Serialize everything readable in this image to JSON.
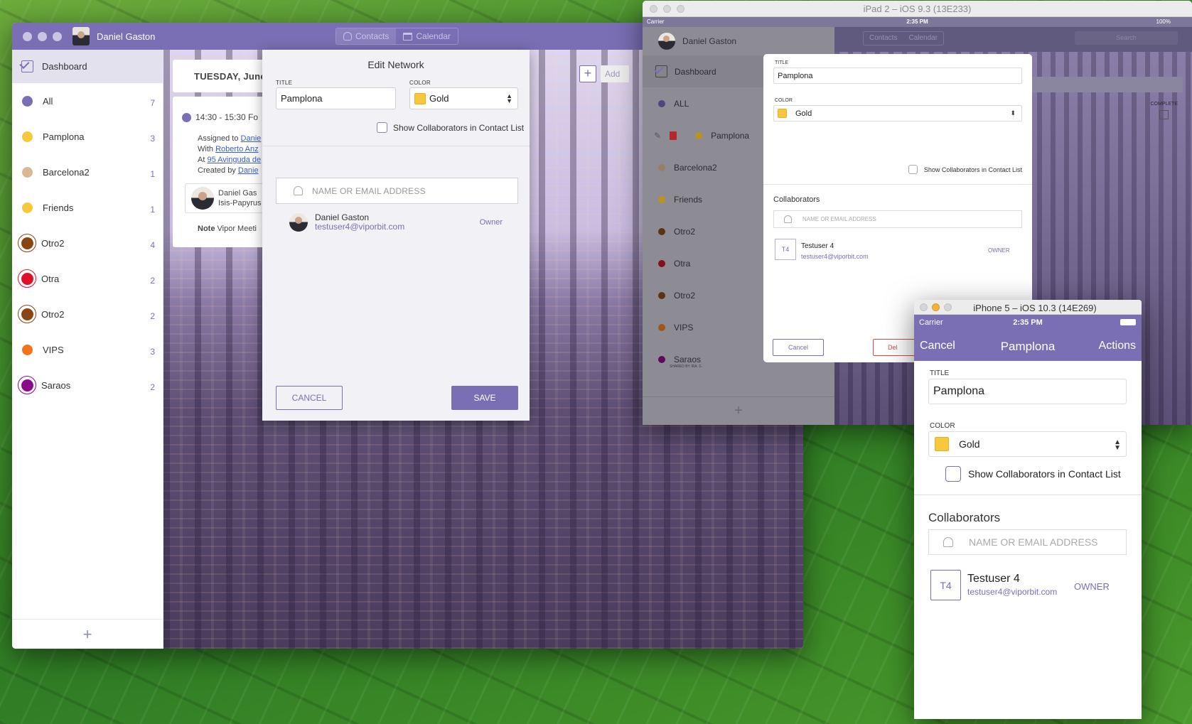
{
  "mac": {
    "user_name": "Daniel Gaston",
    "tabs": [
      "Contacts",
      "Calendar"
    ],
    "sidebar": {
      "dashboard": "Dashboard",
      "items": [
        {
          "label": "All",
          "count": "7",
          "color": "#7a6fb4",
          "style": "dot"
        },
        {
          "label": "Pamplona",
          "count": "3",
          "color": "#f6c83a",
          "style": "dot"
        },
        {
          "label": "Barcelona2",
          "count": "1",
          "color": "#d9b896",
          "style": "dot"
        },
        {
          "label": "Friends",
          "count": "1",
          "color": "#f6c83a",
          "style": "dot"
        },
        {
          "label": "Otro2",
          "count": "4",
          "color": "#8b4513",
          "style": "ring"
        },
        {
          "label": "Otra",
          "count": "2",
          "color": "#e0102a",
          "style": "ring"
        },
        {
          "label": "Otro2",
          "count": "2",
          "color": "#8b4513",
          "style": "ring"
        },
        {
          "label": "VIPS",
          "count": "3",
          "color": "#f2731c",
          "style": "dot"
        },
        {
          "label": "Saraos",
          "count": "2",
          "color": "#8b0a8b",
          "style": "ring"
        }
      ],
      "add": "+"
    },
    "date_header": "TUESDAY, June",
    "add_button": "Add",
    "event": {
      "time": "14:30 - 15:30 Fo",
      "assigned_label": "Assigned to",
      "assigned_link": "Danie",
      "with_label": "With",
      "with_link": "Roberto Anz",
      "at_label": "At",
      "at_link": "95 Avinguda de",
      "created_label": "Created by",
      "created_link": "Danie",
      "contact_name": "Daniel Gas",
      "contact_company": "Isis-Papyrus",
      "note_label": "Note",
      "note_text": "Vipor Meeti"
    },
    "modal": {
      "title": "Edit Network",
      "title_label": "TITLE",
      "title_value": "Pamplona",
      "color_label": "COLOR",
      "color_value": "Gold",
      "show_collab": "Show Collaborators in Contact List",
      "search_placeholder": "NAME OR EMAIL ADDRESS",
      "collaborator": {
        "name": "Daniel Gaston",
        "email": "testuser4@viporbit.com",
        "role": "Owner"
      },
      "cancel": "CANCEL",
      "save": "SAVE"
    }
  },
  "ipad": {
    "window_title": "iPad 2 – iOS 9.3 (13E233)",
    "carrier": "Carrier",
    "time": "2:35 PM",
    "battery": "100%",
    "user_name": "Daniel Gaston",
    "tabs": [
      "Contacts",
      "Calendar"
    ],
    "search": "Search",
    "dashboard": "Dashboard",
    "items": [
      {
        "label": "ALL",
        "color": "#4c4680"
      },
      {
        "label": "Pamplona",
        "color": "#b89322"
      },
      {
        "label": "Barcelona2",
        "color": "#9a7f66"
      },
      {
        "label": "Friends",
        "color": "#b89322"
      },
      {
        "label": "Otro2",
        "color": "#5a3314"
      },
      {
        "label": "Otra",
        "color": "#8a0c1c"
      },
      {
        "label": "Otro2",
        "color": "#5a3314"
      },
      {
        "label": "VIPS",
        "color": "#a35418"
      },
      {
        "label": "Saraos",
        "color": "#5c0a5c"
      }
    ],
    "saraos_sub": "SHARED BY IRA. S.",
    "complete_label": "COMPLETE",
    "sheet": {
      "title_label": "TITLE",
      "title_value": "Pamplona",
      "color_label": "COLOR",
      "color_value": "Gold",
      "show_collab": "Show Collaborators in Contact List",
      "collab_header": "Collaborators",
      "search_placeholder": "NAME OR EMAIL ADDRESS",
      "initials": "T4",
      "name": "Testuser 4",
      "email": "testuser4@viporbit.com",
      "role": "OWNER",
      "cancel": "Cancel",
      "delete": "Del"
    }
  },
  "iphone": {
    "window_title": "iPhone 5 – iOS 10.3 (14E269)",
    "carrier": "Carrier",
    "time": "2:35 PM",
    "nav_cancel": "Cancel",
    "nav_title": "Pamplona",
    "nav_actions": "Actions",
    "title_label": "TITLE",
    "title_value": "Pamplona",
    "color_label": "COLOR",
    "color_value": "Gold",
    "show_collab": "Show Collaborators in Contact List",
    "collab_header": "Collaborators",
    "search_placeholder": "NAME OR EMAIL ADDRESS",
    "initials": "T4",
    "name": "Testuser 4",
    "email": "testuser4@viporbit.com",
    "role": "OWNER"
  }
}
